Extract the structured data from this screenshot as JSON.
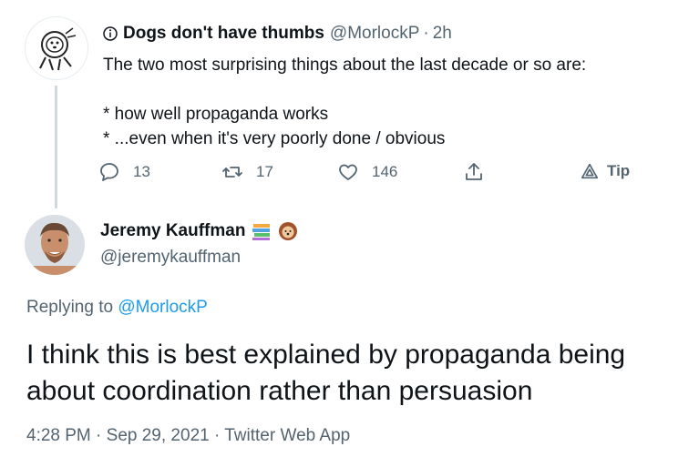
{
  "parent": {
    "display_name": "Dogs don't have thumbs",
    "handle": "@MorlockP",
    "separator": "·",
    "time": "2h",
    "text_lines": [
      "The two most surprising things about the last decade or so are:",
      "* how well propaganda works",
      "* ...even when it's very poorly done / obvious"
    ],
    "actions": {
      "reply_count": "13",
      "retweet_count": "17",
      "like_count": "146",
      "tip_label": "Tip"
    }
  },
  "main": {
    "display_name": "Jeremy Kauffman",
    "handle": "@jeremykauffman",
    "replying_prefix": "Replying to",
    "replying_to": "@MorlockP",
    "text_lines": [
      "I think this is best explained by propaganda being",
      "about coordination rather than persuasion"
    ],
    "time": "4:28 PM",
    "date": "Sep 29, 2021",
    "source": "Twitter Web App",
    "separator": "·"
  },
  "colors": {
    "link": "#1d9bf0",
    "secondary_text": "#536471",
    "primary_text": "#0f1419"
  }
}
